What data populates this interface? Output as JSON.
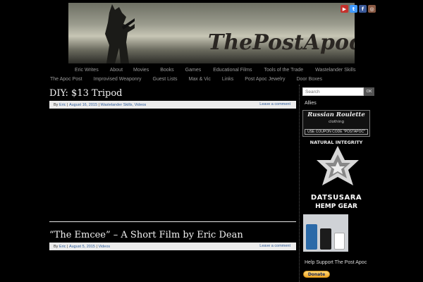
{
  "header": {
    "logo_text": "ThePostApoc.com"
  },
  "social": [
    {
      "icon": "youtube-icon",
      "glyph": "▶",
      "color": "#c4302b"
    },
    {
      "icon": "twitter-icon",
      "glyph": "t",
      "color": "#4099ff"
    },
    {
      "icon": "facebook-icon",
      "glyph": "f",
      "color": "#3b5998"
    },
    {
      "icon": "instagram-icon",
      "glyph": "◎",
      "color": "#8a5a44"
    }
  ],
  "nav": {
    "row1": [
      "Eric Writes",
      "About",
      "Movies",
      "Books",
      "Games",
      "Educational Films",
      "Tools of the Trade",
      "Wastelander Skills"
    ],
    "row2": [
      "The Apoc Post",
      "Improvised Weaponry",
      "Guest Lists",
      "Max & Vic",
      "Links",
      "Post Apoc Jewelry",
      "Door Boxes"
    ]
  },
  "posts": [
    {
      "title": "DIY: $13 Tripod",
      "by": "By",
      "author": "Eric",
      "date": "August 16, 2015",
      "categories": "Wastelander Skills, Videos",
      "comment": "Leave a comment"
    },
    {
      "title": "“The Emcee” – A Short Film by Eric Dean",
      "by": "By",
      "author": "Eric",
      "date": "August 5, 2015",
      "categories": "Videos",
      "comment": "Leave a comment"
    }
  ],
  "sidebar": {
    "search_placeholder": "Search",
    "search_button": "OK",
    "allies_label": "Allies",
    "rr_title": "Russian Roulette",
    "rr_sub": "clothing",
    "rr_coupon": "USE COUPON CODE \"POSTAPOC\"",
    "ni_label": "NATURAL INTEGRITY",
    "ds_name": "DATSUSARA",
    "ds_gear": "HEMP GEAR",
    "support_label": "Help Support The Post Apoc",
    "donate_label": "Donate"
  },
  "colors": {
    "background": "#000000",
    "link": "#2c5b9b",
    "meta_bar": "#ececec"
  }
}
